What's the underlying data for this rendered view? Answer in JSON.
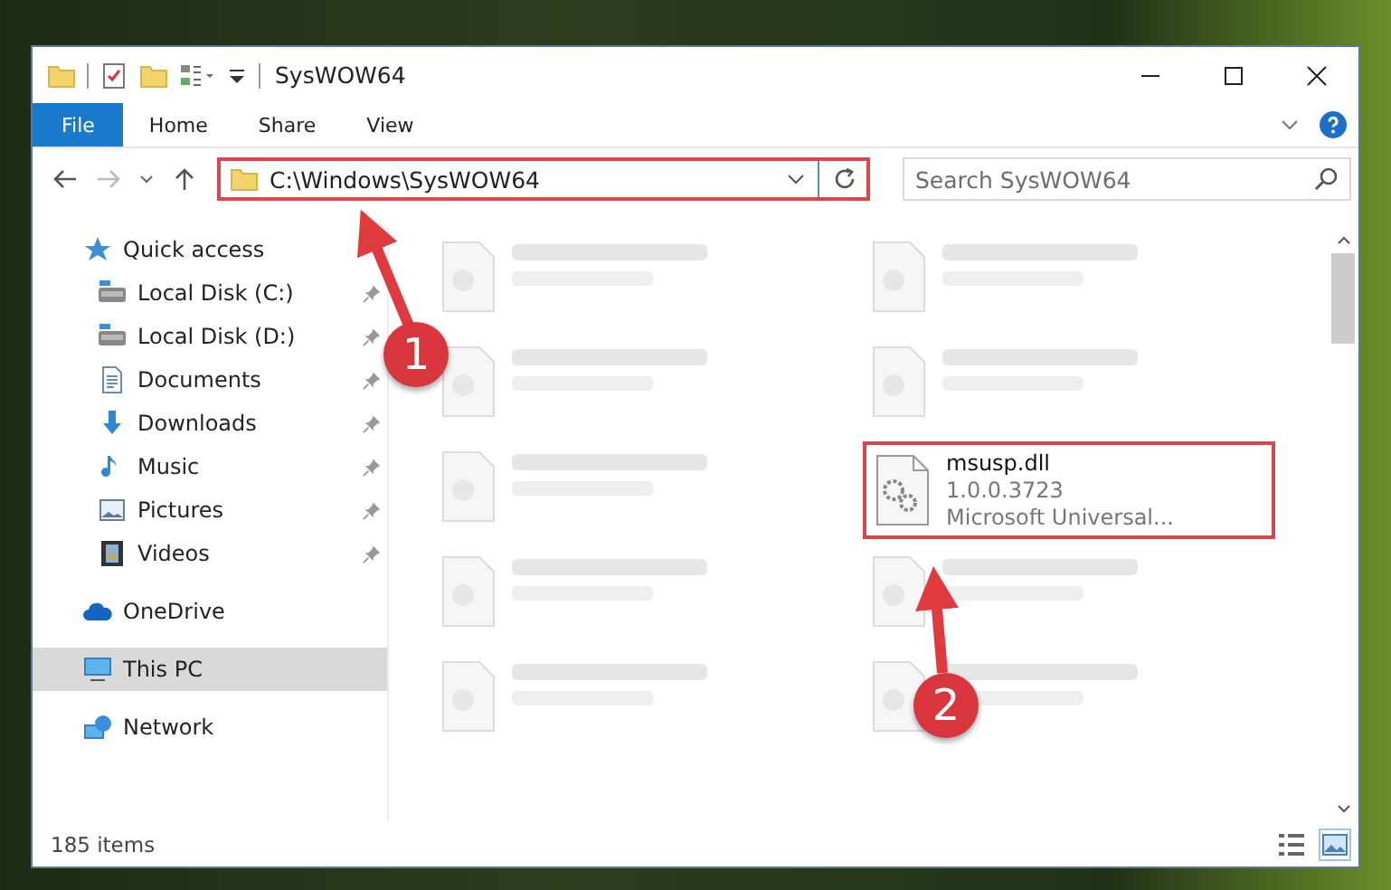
{
  "window": {
    "title": "SysWOW64"
  },
  "ribbon_tabs": [
    {
      "label": "File",
      "selected": true
    },
    {
      "label": "Home",
      "selected": false
    },
    {
      "label": "Share",
      "selected": false
    },
    {
      "label": "View",
      "selected": false
    }
  ],
  "address_bar": {
    "path": "C:\\Windows\\SysWOW64",
    "highlighted": true
  },
  "search": {
    "placeholder": "Search SysWOW64"
  },
  "sidebar": {
    "items": [
      {
        "label": "Quick access",
        "selected": false,
        "pinned": false,
        "children": [
          {
            "label": "Local Disk (C:)",
            "selected": false,
            "pinned": true
          },
          {
            "label": "Local Disk (D:)",
            "selected": false,
            "pinned": true
          },
          {
            "label": "Documents",
            "selected": false,
            "pinned": true
          },
          {
            "label": "Downloads",
            "selected": false,
            "pinned": true
          },
          {
            "label": "Music",
            "selected": false,
            "pinned": true
          },
          {
            "label": "Pictures",
            "selected": false,
            "pinned": true
          },
          {
            "label": "Videos",
            "selected": false,
            "pinned": true
          }
        ]
      },
      {
        "label": "OneDrive",
        "selected": false,
        "pinned": false
      },
      {
        "label": "This PC",
        "selected": true,
        "pinned": false
      },
      {
        "label": "Network",
        "selected": false,
        "pinned": false
      }
    ]
  },
  "files": [
    {
      "kind": "blurred"
    },
    {
      "kind": "blurred"
    },
    {
      "kind": "blurred"
    },
    {
      "kind": "blurred"
    },
    {
      "kind": "blurred"
    },
    {
      "kind": "file",
      "name": "msusp.dll",
      "lines": [
        "1.0.0.3723",
        "Microsoft Universal..."
      ],
      "highlighted": true
    },
    {
      "kind": "blurred"
    },
    {
      "kind": "blurred"
    },
    {
      "kind": "blurred"
    },
    {
      "kind": "blurred"
    }
  ],
  "status_bar": {
    "item_count": "185 items"
  },
  "callouts": [
    {
      "label": "1"
    },
    {
      "label": "2"
    }
  ]
}
